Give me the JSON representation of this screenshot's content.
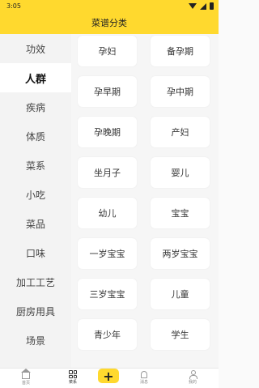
{
  "status_bar": {
    "time": "3:05"
  },
  "header": {
    "title": "菜谱分类"
  },
  "sidebar": {
    "items": [
      {
        "label": "功效"
      },
      {
        "label": "人群"
      },
      {
        "label": "疾病"
      },
      {
        "label": "体质"
      },
      {
        "label": "菜系"
      },
      {
        "label": "小吃"
      },
      {
        "label": "菜品"
      },
      {
        "label": "口味"
      },
      {
        "label": "加工工艺"
      },
      {
        "label": "厨房用具"
      },
      {
        "label": "场景"
      }
    ],
    "active": "人群"
  },
  "grid": {
    "tags": [
      {
        "label": "孕妇"
      },
      {
        "label": "备孕期"
      },
      {
        "label": "孕早期"
      },
      {
        "label": "孕中期"
      },
      {
        "label": "孕晚期"
      },
      {
        "label": "产妇"
      },
      {
        "label": "坐月子"
      },
      {
        "label": "婴儿"
      },
      {
        "label": "幼儿"
      },
      {
        "label": "宝宝"
      },
      {
        "label": "一岁宝宝"
      },
      {
        "label": "两岁宝宝"
      },
      {
        "label": "三岁宝宝"
      },
      {
        "label": "儿童"
      },
      {
        "label": "青少年"
      },
      {
        "label": "学生"
      }
    ]
  },
  "bottom_nav": {
    "items": [
      {
        "label": "首页",
        "icon": "home-icon"
      },
      {
        "label": "菜系",
        "icon": "grid-icon"
      },
      {
        "label": "+",
        "icon": "add-icon"
      },
      {
        "label": "消息",
        "icon": "bell-icon"
      },
      {
        "label": "我的",
        "icon": "user-icon"
      }
    ],
    "active": "菜系"
  },
  "colors": {
    "accent": "#ffd92e"
  }
}
